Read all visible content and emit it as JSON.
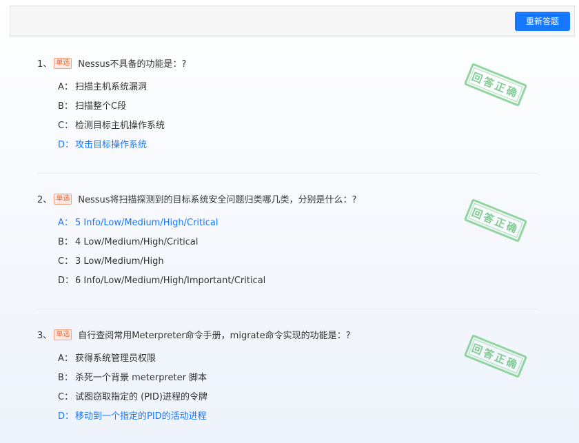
{
  "toolbar": {
    "redo_label": "重新答题"
  },
  "questions": [
    {
      "num": "1、",
      "type": "单选",
      "text": "Nessus不具备的功能是：?",
      "options": [
        {
          "letter": "A：",
          "text": "扫描主机系统漏洞",
          "selected": false
        },
        {
          "letter": "B：",
          "text": "扫描整个C段",
          "selected": false
        },
        {
          "letter": "C：",
          "text": "检测目标主机操作系统",
          "selected": false
        },
        {
          "letter": "D：",
          "text": "攻击目标操作系统",
          "selected": true
        }
      ],
      "result": "回答正确"
    },
    {
      "num": "2、",
      "type": "单选",
      "text": "Nessus将扫描探测到的目标系统安全问题归类哪几类，分别是什么：?",
      "options": [
        {
          "letter": "A：",
          "text": "5 Info/Low/Medium/High/Critical",
          "selected": true
        },
        {
          "letter": "B：",
          "text": "4 Low/Medium/High/Critical",
          "selected": false
        },
        {
          "letter": "C：",
          "text": "3 Low/Medium/High",
          "selected": false
        },
        {
          "letter": "D：",
          "text": "6 Info/Low/Medium/High/Important/Critical",
          "selected": false
        }
      ],
      "result": "回答正确"
    },
    {
      "num": "3、",
      "type": "单选",
      "text": "自行查阅常用Meterpreter命令手册，migrate命令实现的功能是：?",
      "options": [
        {
          "letter": "A：",
          "text": "获得系统管理员权限",
          "selected": false
        },
        {
          "letter": "B：",
          "text": "杀死一个背景 meterpreter 脚本",
          "selected": false
        },
        {
          "letter": "C：",
          "text": "试图窃取指定的 (PID)进程的令牌",
          "selected": false
        },
        {
          "letter": "D：",
          "text": "移动到一个指定的PID的活动进程",
          "selected": true
        }
      ],
      "result": "回答正确"
    }
  ],
  "colors": {
    "accent": "#1677ff",
    "badge": "#f0663a",
    "stamp": "#6fc482"
  }
}
